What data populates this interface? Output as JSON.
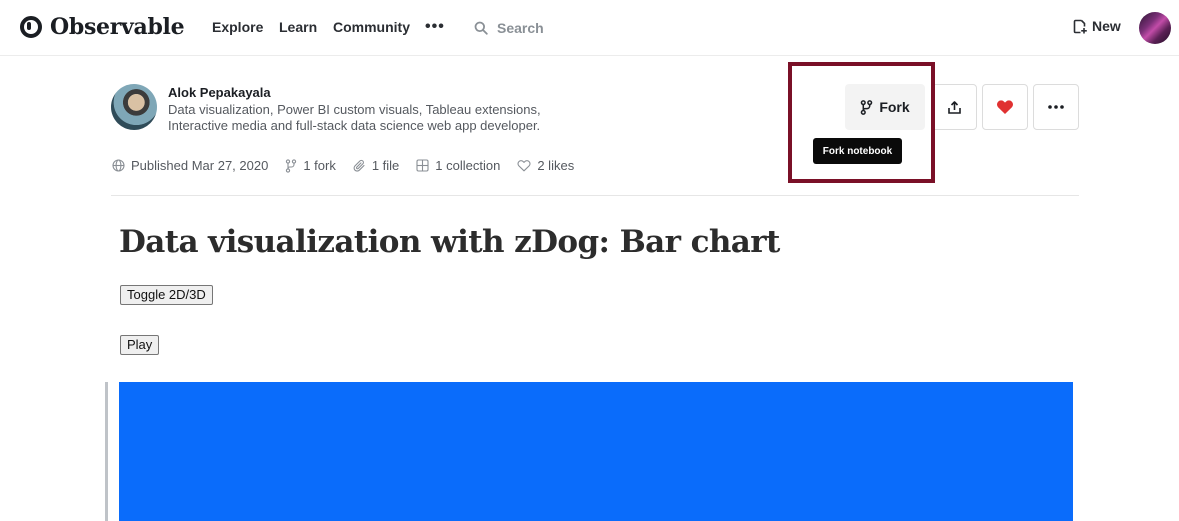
{
  "nav": {
    "logo_text": "Observable",
    "links": [
      "Explore",
      "Learn",
      "Community"
    ],
    "more_label": "•••",
    "search_placeholder": "Search",
    "new_label": "New"
  },
  "author": {
    "name": "Alok Pepakayala",
    "bio": "Data visualization, Power BI custom visuals, Tableau extensions, Interactive media and full-stack data science web app developer."
  },
  "meta": {
    "published": "Published Mar 27, 2020",
    "forks": "1 fork",
    "files": "1 file",
    "collections": "1 collection",
    "likes": "2 likes"
  },
  "actions": {
    "fork_label": "Fork",
    "fork_tooltip": "Fork notebook",
    "like_color": "#e03131",
    "highlight_color": "#7a1027"
  },
  "notebook": {
    "title": "Data visualization with zDog: Bar chart",
    "toggle_button": "Toggle 2D/3D",
    "play_button": "Play",
    "canvas_color": "#0a6cfb"
  }
}
